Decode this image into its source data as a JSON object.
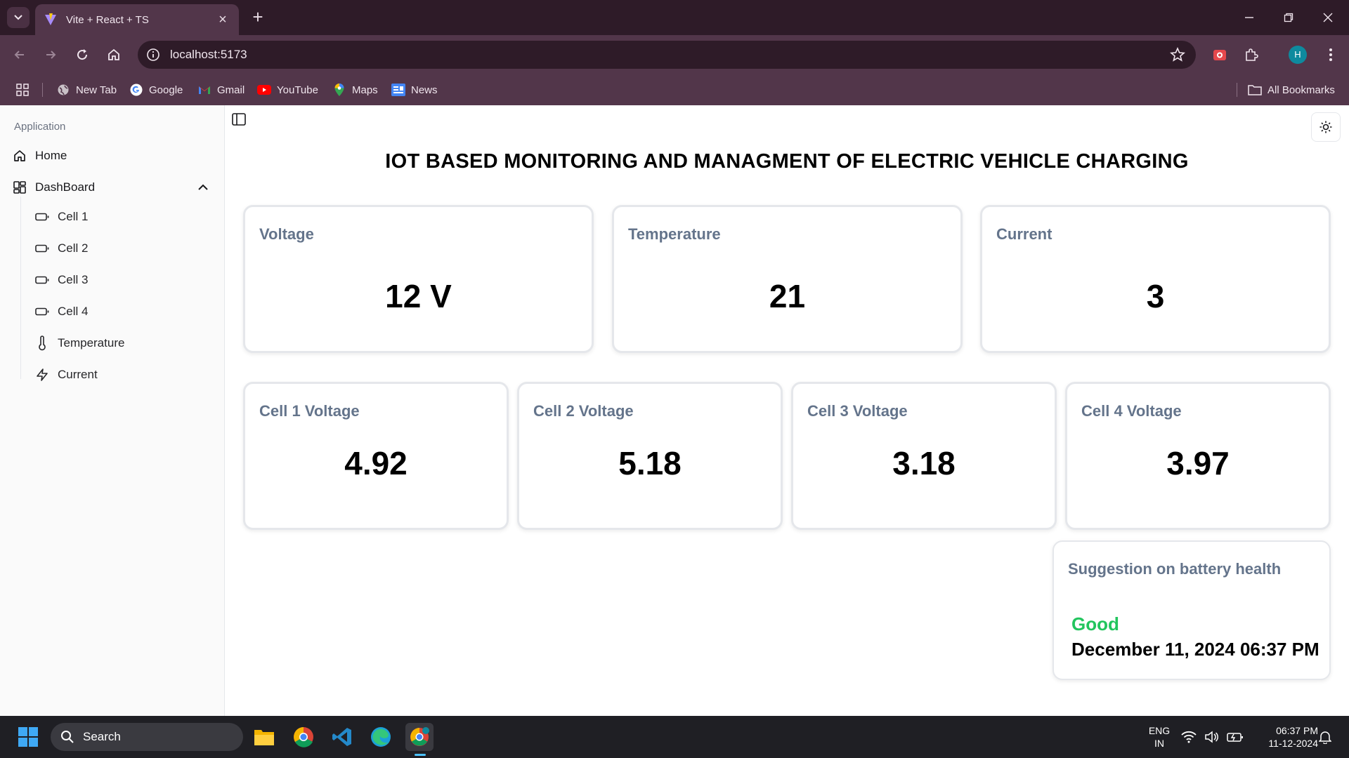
{
  "browser": {
    "tab_title": "Vite + React + TS",
    "url": "localhost:5173",
    "profile_initial": "H",
    "bookmarks": [
      {
        "label": "New Tab",
        "icon": "globe-icon"
      },
      {
        "label": "Google",
        "icon": "google-icon"
      },
      {
        "label": "Gmail",
        "icon": "gmail-icon"
      },
      {
        "label": "YouTube",
        "icon": "youtube-icon"
      },
      {
        "label": "Maps",
        "icon": "maps-icon"
      },
      {
        "label": "News",
        "icon": "news-icon"
      }
    ],
    "all_bookmarks": "All Bookmarks"
  },
  "sidebar": {
    "group_label": "Application",
    "home": "Home",
    "dashboard": "DashBoard",
    "sub_items": [
      {
        "label": "Cell 1",
        "icon": "battery-icon"
      },
      {
        "label": "Cell 2",
        "icon": "battery-icon"
      },
      {
        "label": "Cell 3",
        "icon": "battery-icon"
      },
      {
        "label": "Cell 4",
        "icon": "battery-icon"
      },
      {
        "label": "Temperature",
        "icon": "thermometer-icon"
      },
      {
        "label": "Current",
        "icon": "zap-icon"
      }
    ]
  },
  "main": {
    "title": "IOT BASED MONITORING AND MANAGMENT OF ELECTRIC VEHICLE CHARGING",
    "top_cards": [
      {
        "title": "Voltage",
        "value": "12 V"
      },
      {
        "title": "Temperature",
        "value": "21"
      },
      {
        "title": "Current",
        "value": "3"
      }
    ],
    "cell_cards": [
      {
        "title": "Cell 1 Voltage",
        "value": "4.92"
      },
      {
        "title": "Cell 2 Voltage",
        "value": "5.18"
      },
      {
        "title": "Cell 3 Voltage",
        "value": "3.18"
      },
      {
        "title": "Cell 4 Voltage",
        "value": "3.97"
      }
    ],
    "suggestion": {
      "title": "Suggestion on battery health",
      "status": "Good",
      "status_color": "#22c55e",
      "timestamp": "December 11, 2024 06:37 PM"
    }
  },
  "taskbar": {
    "search_placeholder": "Search",
    "language_line1": "ENG",
    "language_line2": "IN",
    "time": "06:37 PM",
    "date": "11-12-2024"
  }
}
